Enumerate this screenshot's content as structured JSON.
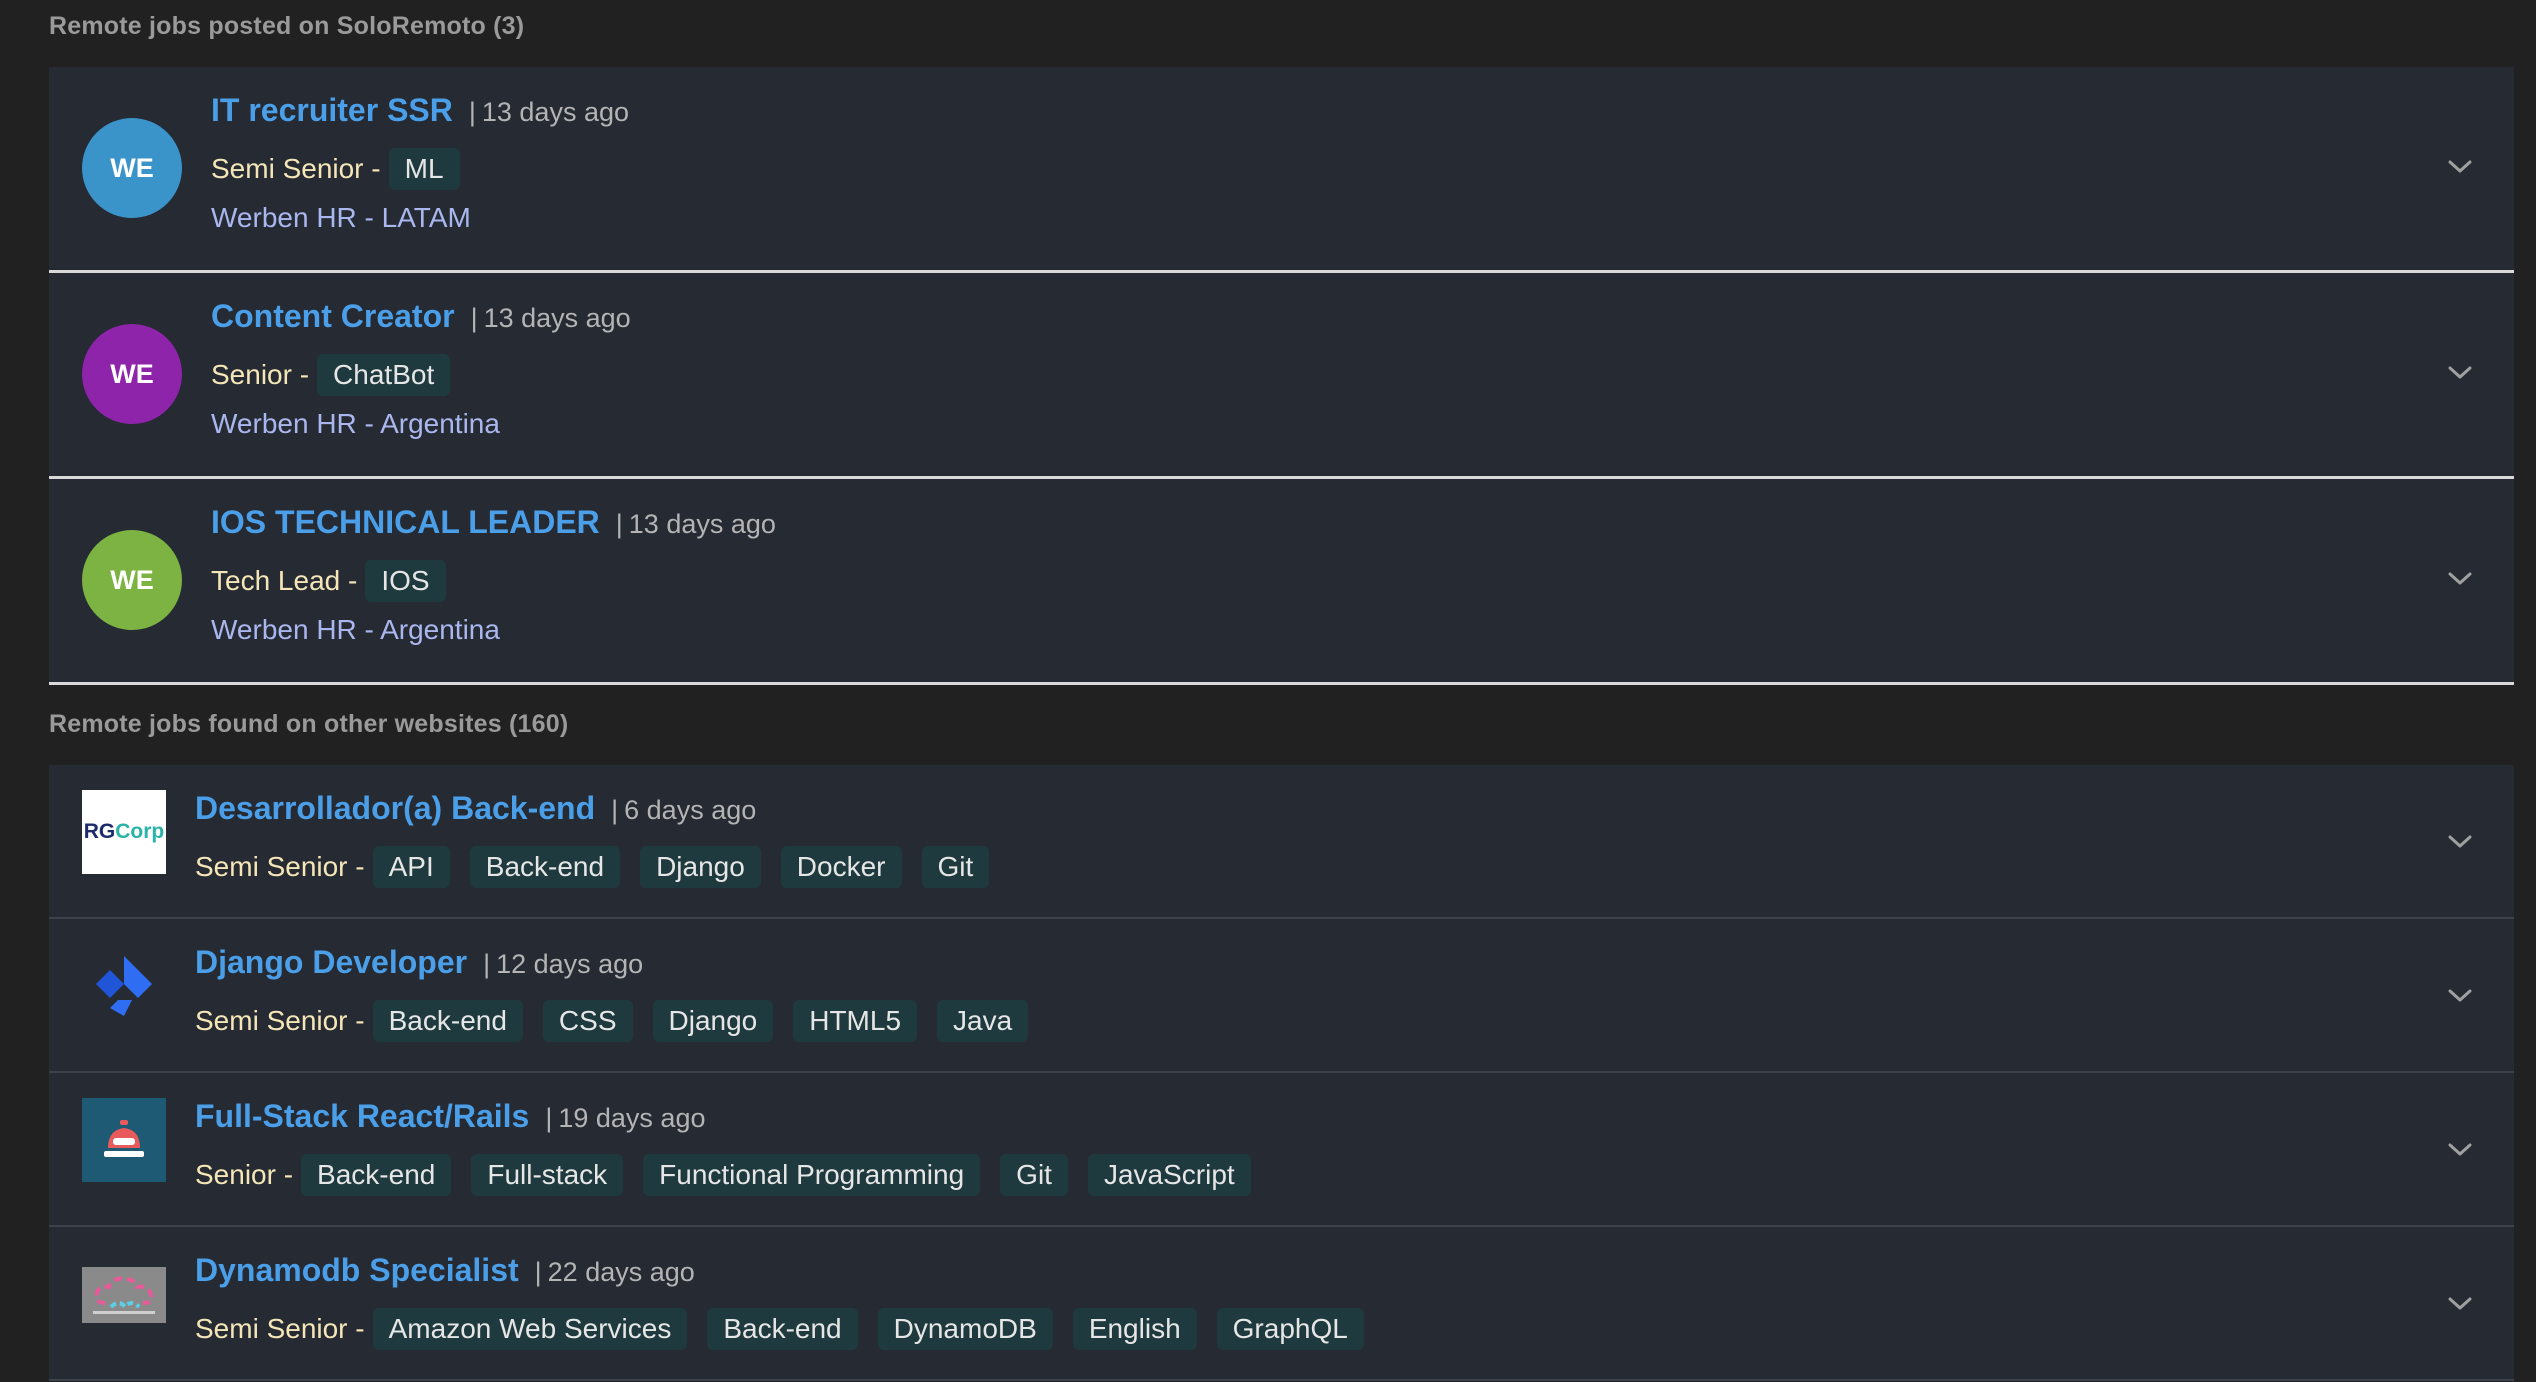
{
  "section_posted": {
    "title": "Remote jobs posted on SoloRemoto (3)"
  },
  "posted_jobs": [
    {
      "avatar_text": "WE",
      "avatar_color": "#3a93c9",
      "title": "IT recruiter SSR",
      "time": "13 days ago",
      "level": "Semi Senior -",
      "tags": [
        "ML"
      ],
      "company": "Werben HR - LATAM"
    },
    {
      "avatar_text": "WE",
      "avatar_color": "#8e24aa",
      "title": "Content Creator",
      "time": "13 days ago",
      "level": "Senior -",
      "tags": [
        "ChatBot"
      ],
      "company": "Werben HR - Argentina"
    },
    {
      "avatar_text": "WE",
      "avatar_color": "#7cb342",
      "title": "IOS TECHNICAL LEADER",
      "time": "13 days ago",
      "level": "Tech Lead -",
      "tags": [
        "IOS"
      ],
      "company": "Werben HR - Argentina"
    }
  ],
  "section_other": {
    "title": "Remote jobs found on other websites (160)"
  },
  "other_jobs": [
    {
      "logo": "rgcorp-logo",
      "logo_text_a": "RG",
      "logo_text_b": "Corp",
      "title": "Desarrollador(a) Back-end",
      "time": "6 days ago",
      "level": "Semi Senior -",
      "tags": [
        "API",
        "Back-end",
        "Django",
        "Docker",
        "Git"
      ]
    },
    {
      "logo": "django-company-logo",
      "title": "Django Developer",
      "time": "12 days ago",
      "level": "Semi Senior -",
      "tags": [
        "Back-end",
        "CSS",
        "Django",
        "HTML5",
        "Java"
      ]
    },
    {
      "logo": "service-bell-logo",
      "title": "Full-Stack React/Rails",
      "time": "19 days ago",
      "level": "Senior -",
      "tags": [
        "Back-end",
        "Full-stack",
        "Functional Programming",
        "Git",
        "JavaScript"
      ]
    },
    {
      "logo": "cloud-coders-logo",
      "title": "Dynamodb Specialist",
      "time": "22 days ago",
      "level": "Semi Senior -",
      "tags": [
        "Amazon Web Services",
        "Back-end",
        "DynamoDB",
        "English",
        "GraphQL"
      ]
    }
  ]
}
